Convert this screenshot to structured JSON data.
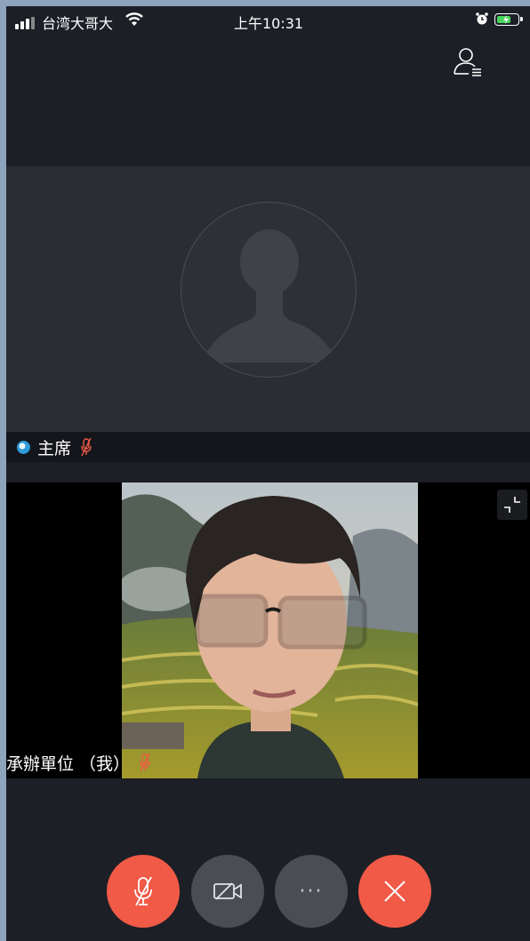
{
  "status_bar": {
    "carrier": "台湾大哥大",
    "time": "上午10:31",
    "battery_color": "#49d65c"
  },
  "header": {
    "participants_icon": "participants-list-icon"
  },
  "host_tile": {
    "avatar_icon": "default-avatar-icon",
    "name": "主席",
    "mic_state": "muted",
    "badge_icon": "host-badge-icon"
  },
  "self_tile": {
    "name": "承辦單位 （我）",
    "mic_state": "muted",
    "shrink_icon": "shrink-icon"
  },
  "controls": {
    "mic_icon": "mic-muted-icon",
    "camera_icon": "camera-off-icon",
    "more_label": "···",
    "hangup_icon": "hangup-x-icon",
    "accent_red": "#f05a46",
    "neutral_gray": "#4a4e54"
  }
}
